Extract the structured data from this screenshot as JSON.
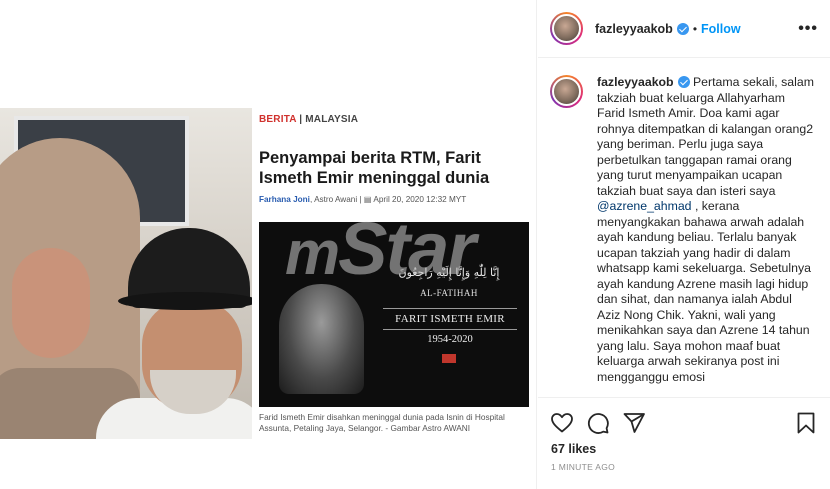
{
  "post_image": {
    "article": {
      "category": "BERITA",
      "section": "| MALAYSIA",
      "headline": "Penyampai berita RTM, Farit Ismeth Emir meninggal dunia",
      "author": "Farhana Joni",
      "meta_rest": ", Astro Awani | ▤ April 20, 2020 12:32 MYT",
      "image_text": {
        "arabic": "إِنَّا لِلّٰهِ وَإِنَّا إِلَيْهِ رَاجِعُونَ",
        "al_fatihah": "AL-FATIHAH",
        "name": "FARIT ISMETH EMIR",
        "years": "1954-2020"
      },
      "caption": "Farid Ismeth Emir disahkan meninggal dunia pada Isnin di Hospital Assunta, Petaling Jaya, Selangor. - Gambar Astro AWANI"
    },
    "watermark": {
      "m": "m",
      "rest": "Star"
    }
  },
  "header": {
    "username": "fazleyyaakob",
    "separator": "•",
    "follow_label": "Follow",
    "more_label": "•••"
  },
  "caption": {
    "username": "fazleyyaakob",
    "text_before_mention": " Pertama sekali, salam takziah buat keluarga Allahyarham Farid Ismeth Amir. Doa kami agar rohnya ditempatkan di kalangan orang2 yang beriman. Perlu juga saya perbetulkan tanggapan ramai orang yang turut menyampaikan ucapan takziah buat saya dan isteri saya ",
    "mention": "@azrene_ahmad",
    "text_after_mention": " , kerana menyangkakan bahawa arwah adalah ayah kandung beliau. Terlalu banyak ucapan takziah yang hadir di dalam whatsapp kami sekeluarga. Sebetulnya ayah kandung Azrene masih lagi hidup dan sihat, dan namanya ialah Abdul Aziz Nong Chik. Yakni, wali yang menikahkan saya dan Azrene 14 tahun yang lalu. Saya mohon maaf buat keluarga arwah sekiranya post ini mengganggu emosi"
  },
  "actions": {
    "likes": "67 likes",
    "time_ago": "1 MINUTE AGO",
    "icons": [
      "heart-icon",
      "comment-icon",
      "share-icon",
      "bookmark-icon"
    ]
  },
  "colors": {
    "follow_blue": "#0095f6",
    "verified_blue": "#3897f0",
    "category_red": "#d0312d",
    "author_blue": "#2a5db0"
  }
}
